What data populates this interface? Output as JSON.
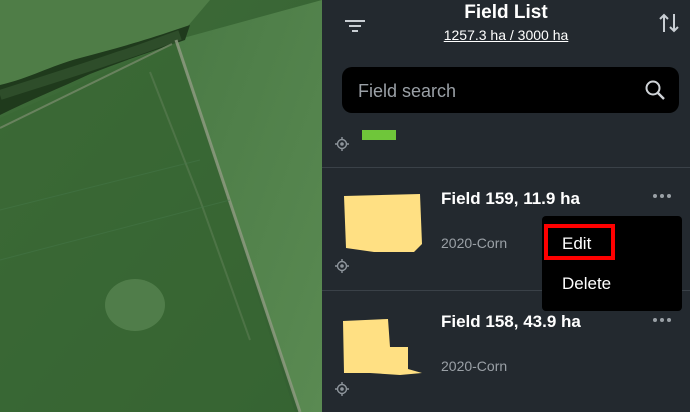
{
  "header": {
    "title": "Field List",
    "area_total": "1257.3 ha / 3000 ha",
    "filter_icon": "filter-icon",
    "sort_icon": "sort-icon"
  },
  "search": {
    "placeholder": "Field search",
    "value": "",
    "icon": "search-icon"
  },
  "fields": [
    {
      "name": "",
      "crop": "",
      "shape_color": "#6fc63a"
    },
    {
      "name": "Field 159, 11.9 ha",
      "crop": "2020-Corn",
      "shape_color": "#ffe083"
    },
    {
      "name": "Field 158, 43.9 ha",
      "crop": "2020-Corn",
      "shape_color": "#ffe083"
    }
  ],
  "context_menu": {
    "edit_label": "Edit",
    "delete_label": "Delete",
    "highlight_color": "#ff0000"
  },
  "colors": {
    "panel_bg": "#23292f",
    "field_shape": "#ffe083",
    "text_secondary": "#9aa0a6"
  }
}
